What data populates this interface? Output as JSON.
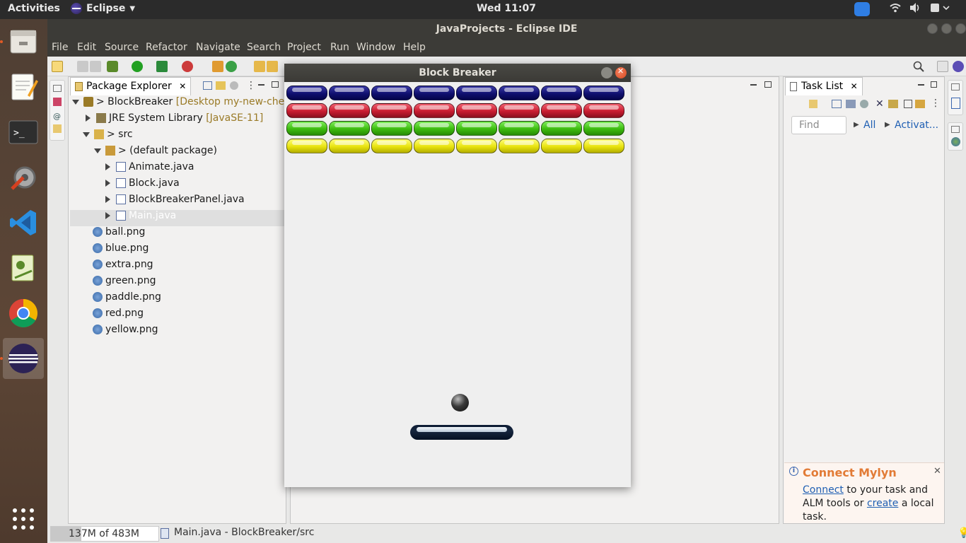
{
  "topbar": {
    "activities": "Activities",
    "app_name": "Eclipse",
    "clock": "Wed 11:07"
  },
  "window": {
    "title": "JavaProjects - Eclipse IDE"
  },
  "menu": {
    "file": "File",
    "edit": "Edit",
    "source": "Source",
    "refactor": "Refactor",
    "navigate": "Navigate",
    "search": "Search",
    "project": "Project",
    "run": "Run",
    "window": "Window",
    "help": "Help"
  },
  "package_explorer": {
    "tab_label": "Package Explorer",
    "project_name": "> BlockBreaker",
    "project_location": "[Desktop my-new-check]",
    "jre_name": "JRE System Library",
    "jre_version": "[JavaSE-11]",
    "src_folder": "> src",
    "default_package": "> (default package)",
    "java_files": [
      "Animate.java",
      "Block.java",
      "BlockBreakerPanel.java",
      "Main.java"
    ],
    "resources": [
      "ball.png",
      "blue.png",
      "extra.png",
      "green.png",
      "paddle.png",
      "red.png",
      "yellow.png"
    ]
  },
  "task_list": {
    "tab_label": "Task List",
    "find_placeholder": "Find",
    "filter_all": "All",
    "filter_activate": "Activat...",
    "mylyn_title": "Connect Mylyn",
    "mylyn_connect": "Connect",
    "mylyn_text1": " to your task and ALM tools or ",
    "mylyn_create": "create",
    "mylyn_text2": " a local task."
  },
  "status": {
    "heap": "137M of 483M",
    "heap_used_fraction": 0.28,
    "message": "Main.java - BlockBreaker/src"
  },
  "game": {
    "title": "Block Breaker",
    "brick_rows": [
      "blue",
      "red",
      "green",
      "yellow"
    ],
    "bricks_per_row": 8
  },
  "colors": {
    "topbar": "#2b2b2b",
    "mylyn_title": "#e27b36",
    "link": "#1f5fb3"
  }
}
